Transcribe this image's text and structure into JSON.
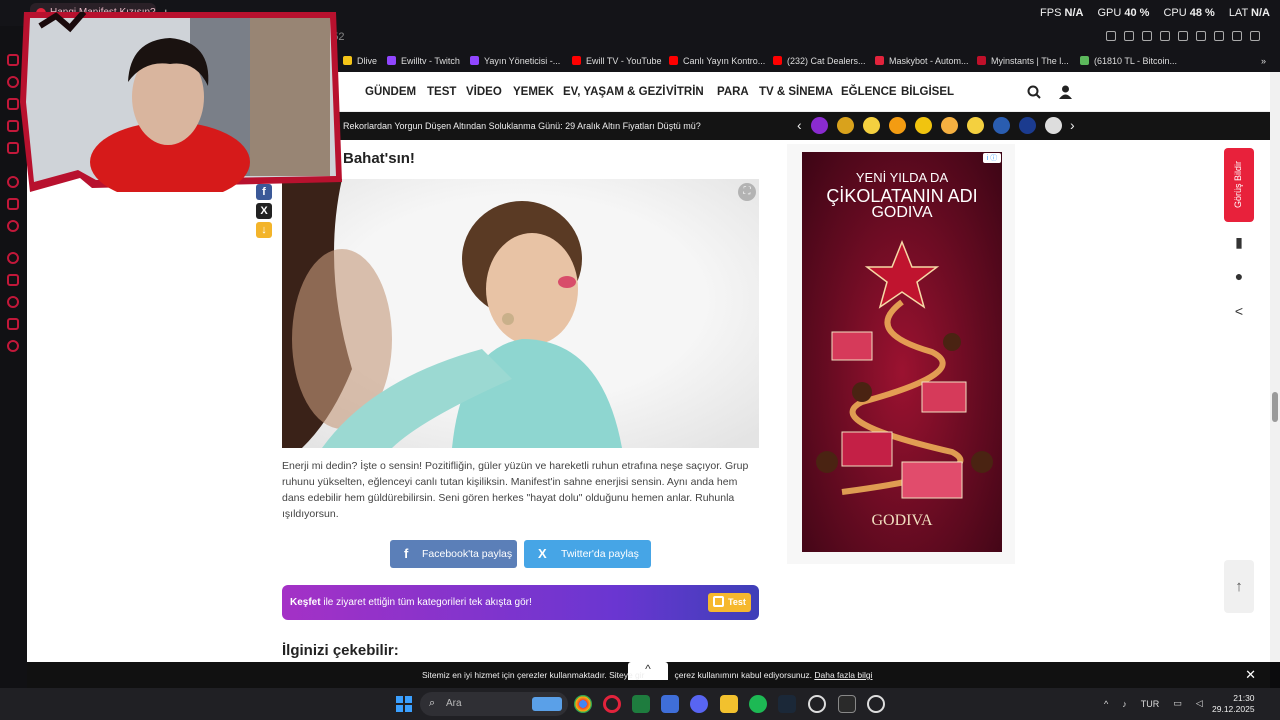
{
  "browser": {
    "tab_title": "Hangi Manifest Kızısın? - C",
    "new_tab": "+",
    "stats": [
      {
        "label": "FPS",
        "value": "N/A"
      },
      {
        "label": "GPU",
        "value": "40 %"
      },
      {
        "label": "CPU",
        "value": "48 %"
      },
      {
        "label": "LAT",
        "value": "N/A"
      }
    ],
    "url_fragment": "1452",
    "bookmarks": [
      {
        "label": "Dlive",
        "color": "#f5c518"
      },
      {
        "label": "Ewilltv - Twitch",
        "color": "#9146ff"
      },
      {
        "label": "Yayın Yöneticisi -...",
        "color": "#9146ff"
      },
      {
        "label": "Ewill TV - YouTube",
        "color": "#ff0000"
      },
      {
        "label": "Canlı Yayın Kontro...",
        "color": "#ff0000"
      },
      {
        "label": "(232) Cat Dealers...",
        "color": "#ff0000"
      },
      {
        "label": "Maskybot - Autom...",
        "color": "#e2233c"
      },
      {
        "label": "Myinstants | The l...",
        "color": "#c0102a"
      },
      {
        "label": "(61810 TL - Bitcoin...",
        "color": "#5cb85c"
      }
    ]
  },
  "site": {
    "nav": [
      "GÜNDEM",
      "TEST",
      "VİDEO",
      "YEMEK",
      "EV, YAŞAM & GEZİ",
      "VİTRİN",
      "PARA",
      "TV & SİNEMA",
      "EĞLENCE",
      "BİLGİSEL"
    ],
    "ticker": "Rekorlardan Yorgun Düşen Altından Soluklanma Günü: 29 Aralık Altın Fiyatları Düştü mü?",
    "ticker_prev": "‹",
    "ticker_next": "›",
    "result_title": "Bahat'sın!",
    "result_text": "Enerji mi dedin? İşte o sensin! Pozitifliğin, güler yüzün ve hareketli ruhun etrafına neşe saçıyor. Grup ruhunu yükselten, eğlenceyi canlı tutan kişiliksin. Manifest'in sahne enerjisi sensin. Aynı anda hem dans edebilir hem güldürebilirsin. Seni gören herkes \"hayat dolu\" olduğunu hemen anlar. Ruhunla ışıldıyorsun.",
    "share_facebook": "Facebook'ta paylaş",
    "share_twitter": "Twitter'da paylaş",
    "kesfet_bold": "Keşfet",
    "kesfet_rest": " ile ziyaret ettiğin tüm kategorileri tek akışta gör!",
    "test_badge": "Test",
    "related_title": "İlginizi çekebilir:",
    "feedback_label": "Görüş Bildir",
    "up_arrow": "↑",
    "side_share": {
      "fb": "f",
      "x": "X",
      "dl": "↓"
    }
  },
  "ad": {
    "line1": "YENİ YILDA DA",
    "line2": "ÇİKOLATANIN ADI",
    "line3": "GODIVA",
    "brand": "GODIVA",
    "adchoice": "i ⓘ"
  },
  "cookie": {
    "text": "Sitemiz en iyi hizmet için çerezler kullanmaktadır. Siteye gir",
    "text2": "çerez kullanımını kabul ediyorsunuz. ",
    "link": "Daha fazla bilgi",
    "close": "✕",
    "up": "^"
  },
  "taskbar": {
    "search_placeholder": "Ara",
    "language": "TUR",
    "time": "21:30",
    "date": "29.12.2025"
  },
  "colors": {
    "accent_red": "#e8213b",
    "facebook": "#5b7fb8",
    "twitter": "#46a5e6",
    "kesfet_start": "#a431c6",
    "kesfet_end": "#3e3fb8"
  }
}
